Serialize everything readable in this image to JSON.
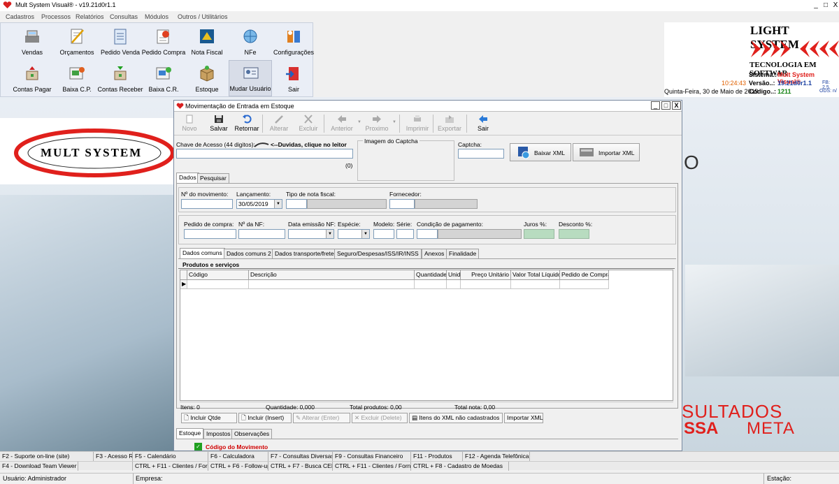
{
  "window": {
    "title": "Mult System Visual® - v19.21d0r1.1",
    "controls": [
      "_",
      "□",
      "X"
    ]
  },
  "menu": [
    "Cadastros",
    "Processos",
    "Relatórios",
    "Consultas",
    "Módulos",
    "Outros / Utilitários"
  ],
  "toolbar": {
    "row1": [
      "Vendas",
      "Orçamentos",
      "Pedido Venda",
      "Pedido Compra",
      "Nota Fiscal",
      "NFe",
      "Configurações"
    ],
    "row2": [
      "Contas Pagar",
      "Baixa C.P.",
      "Contas Receber",
      "Baixa C.R.",
      "Estoque",
      "Mudar Usuário",
      "Sair"
    ]
  },
  "brand": {
    "name": "LIGHT SYSTEM",
    "tagline": "TECNOLOGIA EM SOFTWAR",
    "clock": "10:24:43",
    "system_label": "Sistema.:",
    "system_value": "Mult System Visual®",
    "version_label": "Versão..:",
    "version_value": "19.21d0r1.1",
    "fb": "FB: 2.5.",
    "date": "Quinta-Feira, 30 de Maio de 2019",
    "code_label": "Código..:",
    "code_value": "1211",
    "ods": "ODS: n/"
  },
  "wallpaper": {
    "logo_text": "MULT SYSTEM",
    "text_right": "O",
    "text_bottom1": "SULTADOS",
    "text_bottom2_red": "SSA",
    "text_bottom2_black": "META"
  },
  "dialog": {
    "title": "Movimentação de Entrada em Estoque",
    "controls": [
      "_",
      "□",
      "X"
    ],
    "toolbar": [
      {
        "label": "Novo",
        "enabled": false
      },
      {
        "label": "Salvar",
        "enabled": true
      },
      {
        "label": "Retornar",
        "enabled": true
      },
      {
        "label": "Alterar",
        "enabled": false
      },
      {
        "label": "Excluir",
        "enabled": false
      },
      {
        "label": "Anterior",
        "enabled": false
      },
      {
        "label": "Proximo",
        "enabled": false
      },
      {
        "label": "Imprimir",
        "enabled": false
      },
      {
        "label": "Exportar",
        "enabled": false
      },
      {
        "label": "Sair",
        "enabled": true
      }
    ],
    "chave_label": "Chave de Acesso (44 digitos):",
    "duvidas": "<--Duvidas, clique no leitor",
    "chave_count": "(0)",
    "captcha_image_label": "Imagem do Captcha",
    "captcha_label": "Captcha:",
    "baixar_xml": "Baixar XML",
    "importar_xml": "Importar XML",
    "tabs_top": [
      "Dados",
      "Pesquisar"
    ],
    "fields1": {
      "movimento": "Nº do movimento:",
      "lancamento": "Lançamento:",
      "lancamento_value": "30/05/2019",
      "tipo_nota": "Tipo de nota fiscal:",
      "fornecedor": "Fornecedor:"
    },
    "fields2": {
      "pedido_compra": "Pedido de compra:",
      "nf": "Nº da NF:",
      "data_emissao": "Data emissão NF:",
      "especie": "Espécie:",
      "modelo": "Modelo:",
      "serie": "Série:",
      "condicao": "Condição de pagamento:",
      "juros": "Juros %:",
      "desconto": "Desconto %:"
    },
    "tabs_mid": [
      "Dados comuns",
      "Dados comuns 2",
      "Dados transporte/frete",
      "Seguro/Despesas/ISS/IR/INSS",
      "Anexos",
      "Finalidade"
    ],
    "products_title": "Produtos e serviços",
    "grid_columns": [
      "Código",
      "Descrição",
      "Quantidade",
      "Unid",
      "Preço Unitário",
      "Valor Total Líquido",
      "Pedido de Compra"
    ],
    "summary": {
      "itens": "Itens: 0",
      "quantidade": "Quantidade: 0,000",
      "total_produtos": "Total produtos: 0,00",
      "total_nota": "Total nota: 0,00"
    },
    "grid_buttons": [
      {
        "label": "Incluir Qtde",
        "enabled": true
      },
      {
        "label": "Incluir (Insert)",
        "enabled": true
      },
      {
        "label": "Alterar (Enter)",
        "enabled": false
      },
      {
        "label": "Excluir (Delete)",
        "enabled": false
      },
      {
        "label": "Itens do XML não cadastrados",
        "enabled": true
      },
      {
        "label": "Importar XML",
        "enabled": true
      }
    ],
    "tabs_bottom": [
      "Estoque",
      "Impostos",
      "Observações"
    ],
    "hint": "Código do Movimento"
  },
  "fkeys_row1": [
    "F2 - Suporte on-line (site)",
    "F3 - Acesso Rápido",
    "F5 - Calendário",
    "F6 - Calculadora",
    "F7 - Consultas Diversas",
    "F9 - Consultas Financeiro",
    "F11 - Produtos",
    "F12 - Agenda Telefônica"
  ],
  "fkeys_row2": [
    "F4 - Download Team Viewer",
    "CTRL + F11 - Clientes / Forn",
    "CTRL + F6 - Follow-up",
    "CTRL + F7 - Busca CEP",
    "CTRL + F11 - Clientes / Forn",
    "CTRL + F8 - Cadastro de Moedas"
  ],
  "status": {
    "usuario": "Usuário: Administrador",
    "empresa": "Empresa:",
    "estacao": "Estação:"
  },
  "colors": {
    "accent_red": "#e0201c",
    "brand_blue": "#1a3fa0",
    "clock_orange": "#e06000"
  }
}
